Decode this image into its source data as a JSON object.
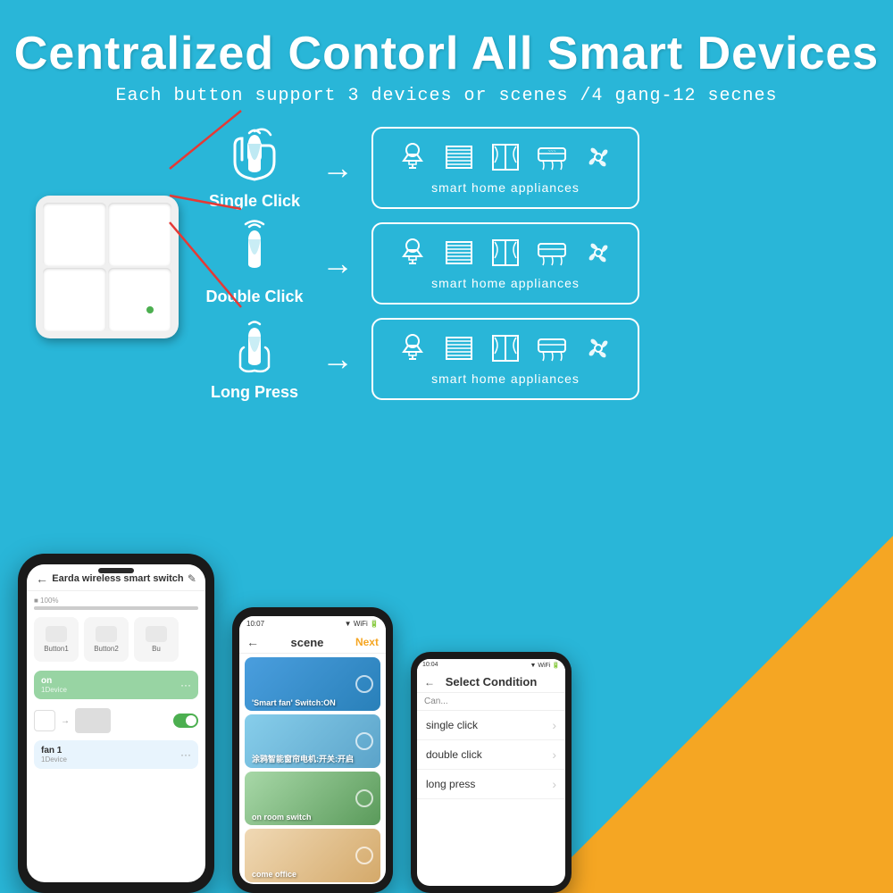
{
  "header": {
    "main_title": "Centralized Contorl All Smart Devices",
    "sub_title": "Each button support 3 devices or scenes /4 gang-12 secnes"
  },
  "actions": [
    {
      "id": "single-click",
      "label": "Single Click",
      "appliance_label": "smart  home appliances"
    },
    {
      "id": "double-click",
      "label": "Double Click",
      "appliance_label": "smart  home appliances"
    },
    {
      "id": "long-press",
      "label": "Long Press",
      "appliance_label": "smart  home appliances"
    }
  ],
  "phone_main": {
    "title": "Earda wireless smart switch",
    "progress": "100%",
    "buttons": [
      "Button1",
      "Button2",
      "Bu"
    ],
    "on_section": {
      "label": "on",
      "sub": "1Device"
    },
    "fan_section": {
      "label": "fan 1",
      "sub": "1Device"
    }
  },
  "phone_mid": {
    "time": "10:07",
    "title": "scene",
    "next_label": "Next",
    "scenes": [
      {
        "label": "'Smart fan' Switch:ON",
        "bg": "scene-bg-1"
      },
      {
        "label": "涂鸦智能窗帘电机:开关:开启",
        "bg": "scene-bg-2"
      },
      {
        "label": "on room switch",
        "bg": "scene-bg-3"
      },
      {
        "label": "come office",
        "bg": "scene-bg-4"
      }
    ]
  },
  "phone_right": {
    "time": "10:04",
    "title": "Select Condition",
    "can_label": "Can...",
    "conditions": [
      {
        "label": "single click"
      },
      {
        "label": "double click"
      },
      {
        "label": "long press"
      }
    ]
  },
  "colors": {
    "bg": "#29b6d8",
    "orange": "#f5a623",
    "white": "#ffffff"
  }
}
